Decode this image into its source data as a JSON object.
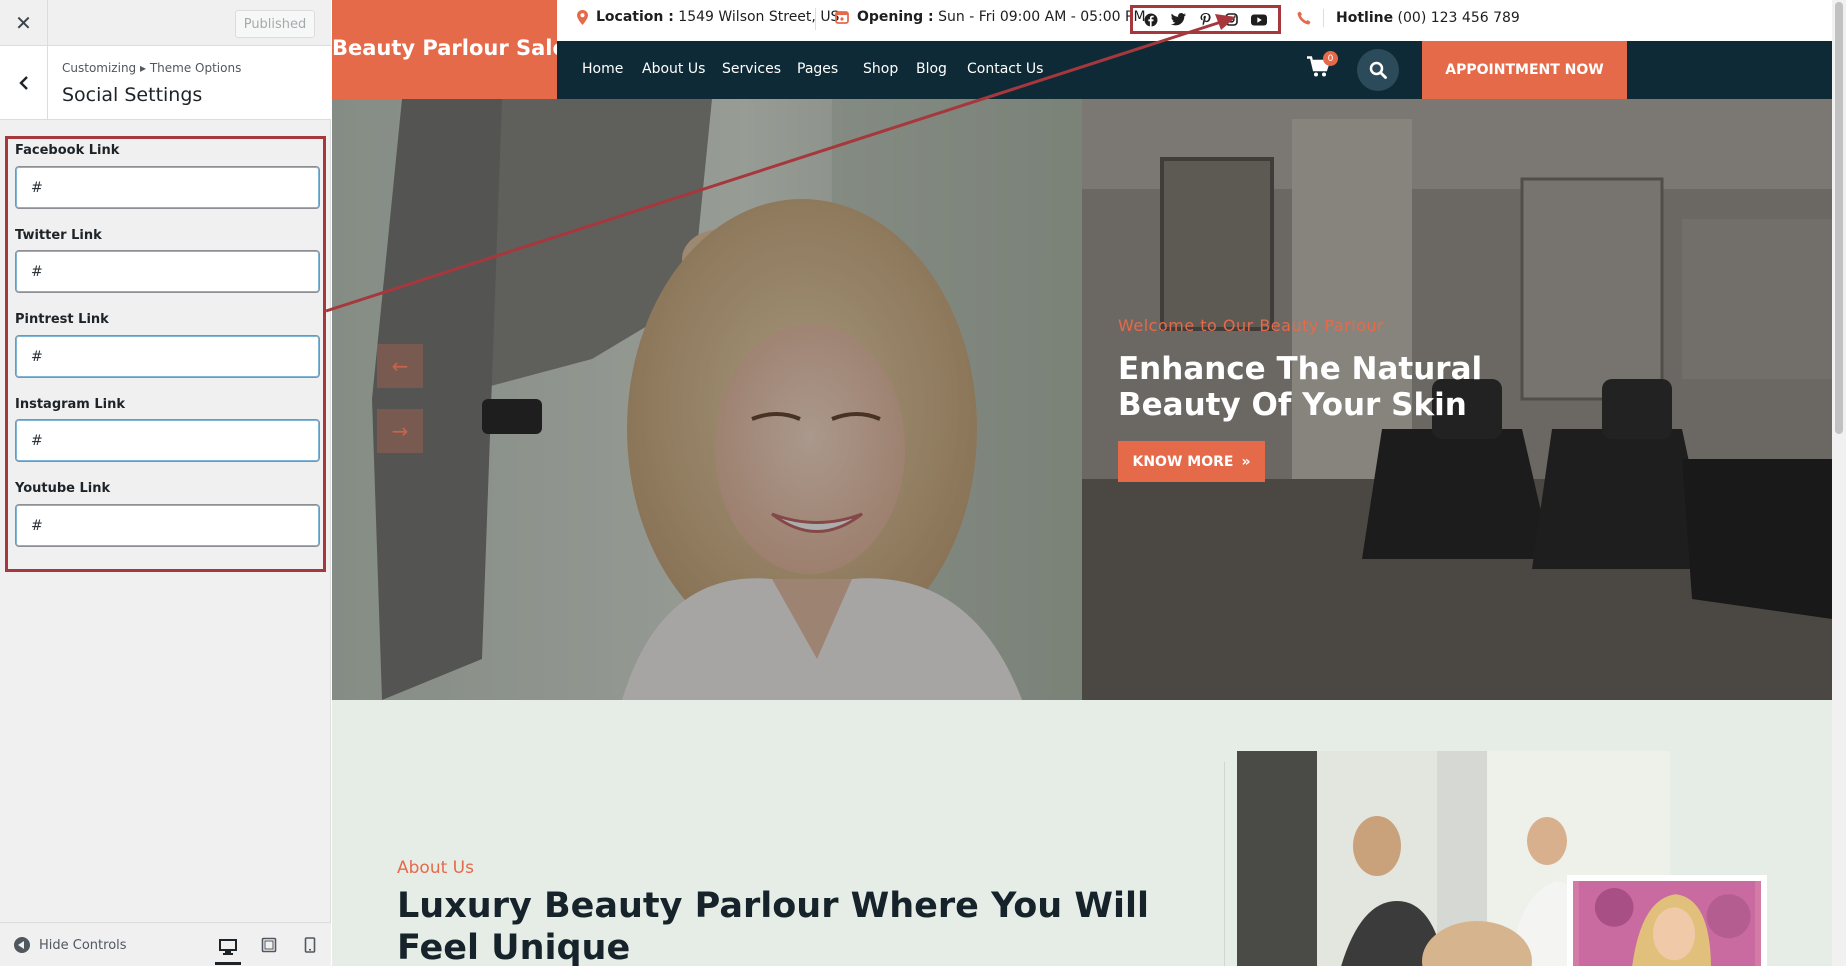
{
  "customizer": {
    "close_icon": "close-icon",
    "published_label": "Published",
    "breadcrumb": "Customizing ▸ Theme Options",
    "section_title": "Social Settings",
    "fields": [
      {
        "label": "Facebook Link",
        "value": "#"
      },
      {
        "label": "Twitter Link",
        "value": "#"
      },
      {
        "label": "Pintrest Link",
        "value": "#"
      },
      {
        "label": "Instagram Link",
        "value": "#"
      },
      {
        "label": "Youtube Link",
        "value": "#"
      }
    ],
    "footer": {
      "hide_controls": "Hide Controls",
      "devices": [
        "desktop",
        "tablet",
        "mobile"
      ],
      "active_device": "desktop"
    },
    "highlight_color": "#a6383d"
  },
  "site": {
    "title": "Beauty Parlour Salon",
    "topbar": {
      "location_label": "Location :",
      "location_value": "1549 Wilson Street, US",
      "opening_label": "Opening :",
      "opening_value": "Sun - Fri 09:00 AM - 05:00 PM",
      "hotline_label": "Hotline",
      "hotline_value": "(00) 123 456 789",
      "social_icons": [
        "facebook-icon",
        "twitter-icon",
        "pinterest-icon",
        "instagram-icon",
        "youtube-icon"
      ]
    },
    "nav": {
      "links": [
        "Home",
        "About Us",
        "Services",
        "Pages",
        "Shop",
        "Blog",
        "Contact Us"
      ],
      "cart_count": "0",
      "appointment": "APPOINTMENT NOW"
    },
    "hero": {
      "eyebrow": "Welcome to Our Beauty Parlour",
      "title": "Enhance The Natural Beauty Of Your Skin",
      "button": "KNOW MORE"
    },
    "about": {
      "eyebrow": "About Us",
      "title": "Luxury Beauty Parlour Where You Will Feel Unique"
    },
    "colors": {
      "accent": "#e56a4a",
      "nav_bg": "#0f2a37",
      "about_bg": "#e6ede7"
    }
  }
}
